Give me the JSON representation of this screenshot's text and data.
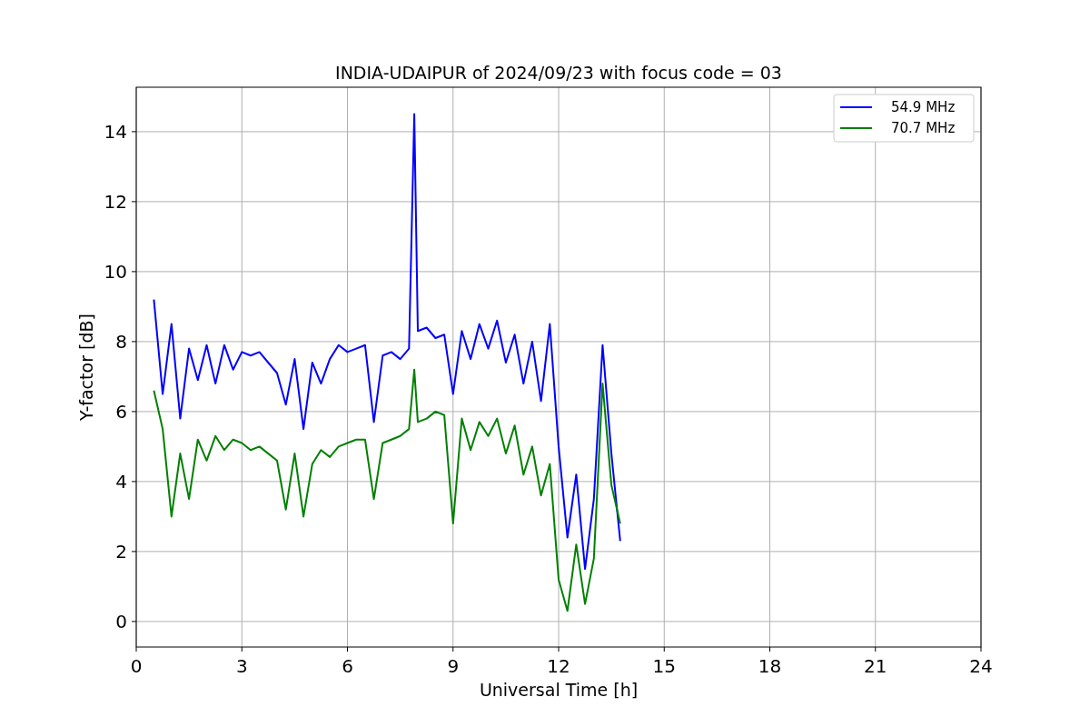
{
  "figure": {
    "chart_data": {
      "type": "line",
      "title": "INDIA-UDAIPUR of 2024/09/23 with focus code = 03",
      "xlabel": "Universal Time [h]",
      "ylabel": "Y-factor [dB]",
      "x": [
        0.5,
        0.75,
        1,
        1.25,
        1.5,
        1.75,
        2,
        2.25,
        2.5,
        2.75,
        3,
        3.25,
        3.5,
        3.75,
        4,
        4.25,
        4.5,
        4.75,
        5,
        5.25,
        5.5,
        5.75,
        6,
        6.25,
        6.5,
        6.75,
        7,
        7.25,
        7.5,
        7.75,
        7.9,
        8,
        8.25,
        8.5,
        8.75,
        9,
        9.25,
        9.5,
        9.75,
        10,
        10.25,
        10.5,
        10.75,
        11,
        11.25,
        11.5,
        11.75,
        12,
        12.25,
        12.5,
        12.75,
        13,
        13.25,
        13.5,
        13.75
      ],
      "series": [
        {
          "name": "54.9 MHz",
          "color": "#0000ff",
          "values": [
            9.2,
            6.5,
            8.5,
            5.8,
            7.8,
            6.9,
            7.9,
            6.8,
            7.9,
            7.2,
            7.7,
            7.6,
            7.7,
            7.4,
            7.1,
            6.2,
            7.5,
            5.5,
            7.4,
            6.8,
            7.5,
            7.9,
            7.7,
            7.8,
            7.9,
            5.7,
            7.6,
            7.7,
            7.5,
            7.8,
            14.5,
            8.3,
            8.4,
            8.1,
            8.2,
            6.5,
            8.3,
            7.5,
            8.5,
            7.8,
            8.6,
            7.4,
            8.2,
            6.8,
            8.0,
            6.3,
            8.5,
            5.0,
            2.4,
            4.2,
            1.5,
            3.5,
            7.9,
            4.8,
            2.3
          ]
        },
        {
          "name": "70.7 MHz",
          "color": "#008000",
          "values": [
            6.6,
            5.5,
            3.0,
            4.8,
            3.5,
            5.2,
            4.6,
            5.3,
            4.9,
            5.2,
            5.1,
            4.9,
            5.0,
            4.8,
            4.6,
            3.2,
            4.8,
            3.0,
            4.5,
            4.9,
            4.7,
            5.0,
            5.1,
            5.2,
            5.2,
            3.5,
            5.1,
            5.2,
            5.3,
            5.5,
            7.2,
            5.7,
            5.8,
            6.0,
            5.9,
            2.8,
            5.8,
            4.9,
            5.7,
            5.3,
            5.8,
            4.8,
            5.6,
            4.2,
            5.0,
            3.6,
            4.5,
            1.2,
            0.3,
            2.2,
            0.5,
            1.8,
            6.8,
            3.9,
            2.8
          ]
        }
      ],
      "grid": true,
      "legend": true,
      "xlim": [
        0,
        24
      ],
      "ylim": [
        -0.73,
        15.27
      ],
      "xticks": [
        0,
        3,
        6,
        9,
        12,
        15,
        18,
        21,
        24
      ],
      "yticks": [
        0,
        2,
        4,
        6,
        8,
        10,
        12,
        14
      ]
    }
  }
}
